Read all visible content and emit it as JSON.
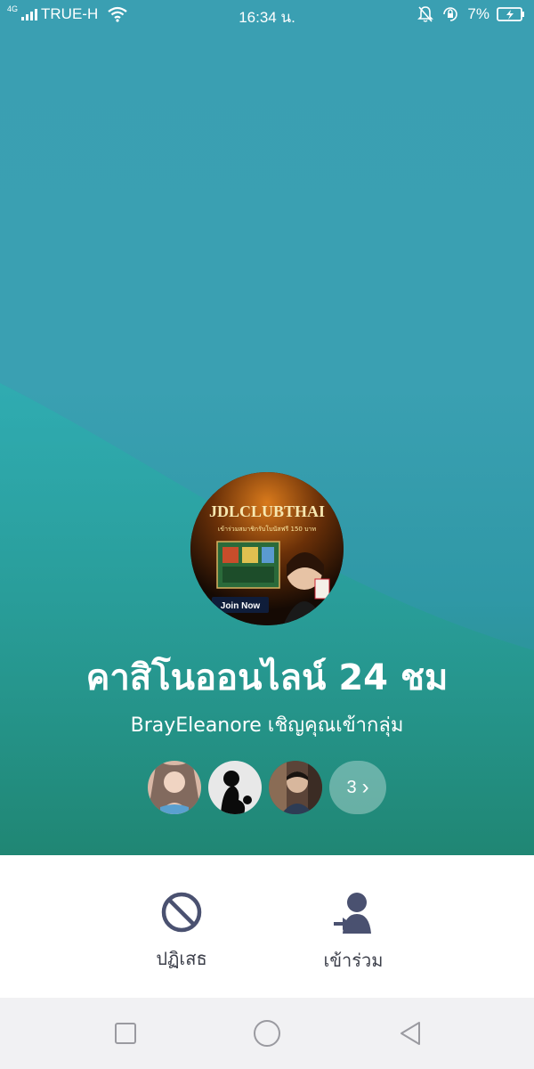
{
  "status_bar": {
    "network_tag": "4G",
    "carrier": "TRUE-H",
    "time": "16:34 น.",
    "battery": "7%",
    "icons": [
      "signal-icon",
      "wifi-icon",
      "bell-off-icon",
      "rotation-lock-icon",
      "battery-charging-icon"
    ]
  },
  "group": {
    "name": "คาสิโนออนไลน์ 24 ชม",
    "invite_text": "BrayEleanore เชิญคุณเข้ากลุ่ม",
    "avatar_banner": {
      "title": "JDLCLUBTHAI",
      "subtitle": "เข้าร่วมสมาชิกรับโบนัสฟรี 150 บาท",
      "button": "Join Now"
    },
    "members_more_count": "3",
    "members_more_chevron": "›"
  },
  "actions": {
    "decline_label": "ปฏิเสธ",
    "join_label": "เข้าร่วม"
  },
  "colors": {
    "hero_top": "#3a9fb2",
    "hero_bottom": "#238778",
    "action_icon": "#4a5170",
    "navbar": "#f1f1f3"
  }
}
